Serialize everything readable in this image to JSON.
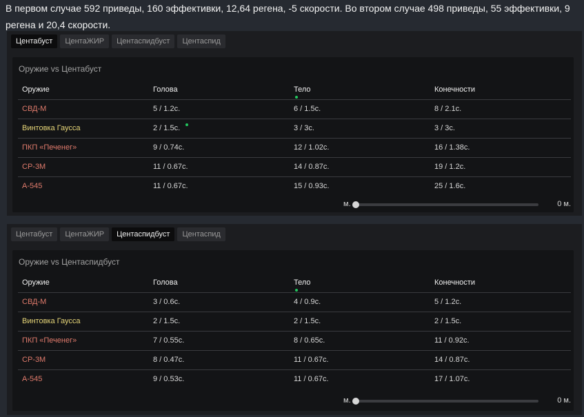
{
  "intro": "В первом случае 592 приведы, 160 эффективки, 12,64 регена, -5 скорости. Во втором случае 498 приведы, 55 эффективки, 9 регена и 20,4 скорости.",
  "colors": {
    "weapon_red": "#e07b6c",
    "weapon_gold": "#e7d679",
    "indicator_green": "#22c55e"
  },
  "panels": [
    {
      "tabs": [
        "Центабуст",
        "ЦентаЖИР",
        "Центаспидбуст",
        "Центаспид"
      ],
      "active_tab": 0,
      "card_title": "Оружие vs Центабуст",
      "headers": [
        "Оружие",
        "Голова",
        "Тело",
        "Конечности"
      ],
      "rows": [
        {
          "weapon": "СВД-М",
          "color": "red",
          "head": "5 / 1.2с.",
          "body": "6 / 1.5с.",
          "limbs": "8 / 2.1с."
        },
        {
          "weapon": "Винтовка Гаусса",
          "color": "gold",
          "head": "2 / 1.5с.",
          "body": "3 / 3с.",
          "limbs": "3 / 3с."
        },
        {
          "weapon": "ПКП «Печенег»",
          "color": "red",
          "head": "9 / 0.74с.",
          "body": "12 / 1.02с.",
          "limbs": "16 / 1.38с."
        },
        {
          "weapon": "СР-3М",
          "color": "red",
          "head": "11 / 0.67с.",
          "body": "14 / 0.87с.",
          "limbs": "19 / 1.2с."
        },
        {
          "weapon": "А-545",
          "color": "red",
          "head": "11 / 0.67с.",
          "body": "15 / 0.93с.",
          "limbs": "25 / 1.6с."
        }
      ],
      "slider": {
        "min_label": "м.",
        "value_label": "0 м.",
        "level": 0
      }
    },
    {
      "tabs": [
        "Центабуст",
        "ЦентаЖИР",
        "Центаспидбуст",
        "Центаспид"
      ],
      "active_tab": 2,
      "card_title": "Оружие vs Центаспидбуст",
      "headers": [
        "Оружие",
        "Голова",
        "Тело",
        "Конечности"
      ],
      "rows": [
        {
          "weapon": "СВД-М",
          "color": "red",
          "head": "3 / 0.6с.",
          "body": "4 / 0.9с.",
          "limbs": "5 / 1.2с."
        },
        {
          "weapon": "Винтовка Гаусса",
          "color": "gold",
          "head": "2 / 1.5с.",
          "body": "2 / 1.5с.",
          "limbs": "2 / 1.5с."
        },
        {
          "weapon": "ПКП «Печенег»",
          "color": "red",
          "head": "7 / 0.55с.",
          "body": "8 / 0.65с.",
          "limbs": "11 / 0.92с."
        },
        {
          "weapon": "СР-3М",
          "color": "red",
          "head": "8 / 0.47с.",
          "body": "11 / 0.67с.",
          "limbs": "14 / 0.87с."
        },
        {
          "weapon": "А-545",
          "color": "red",
          "head": "9 / 0.53с.",
          "body": "11 / 0.67с.",
          "limbs": "17 / 1.07с."
        }
      ],
      "slider": {
        "min_label": "м.",
        "value_label": "0 м.",
        "level": 0
      }
    }
  ]
}
